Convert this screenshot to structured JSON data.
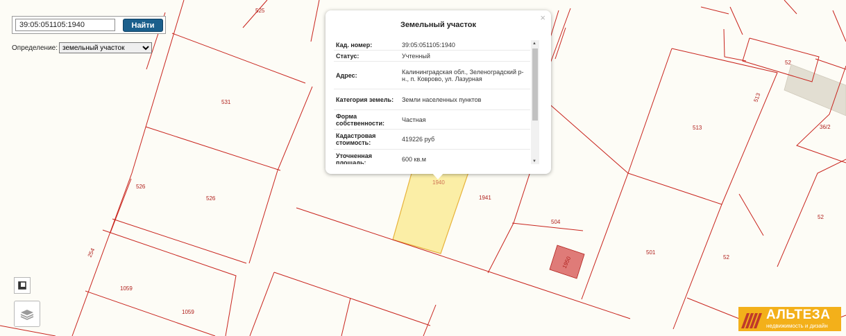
{
  "search": {
    "value": "39:05:051105:1940",
    "button_label": "Найти"
  },
  "definition": {
    "label": "Определение:",
    "selected": "земельный участок"
  },
  "popup": {
    "title": "Земельный участок",
    "close": "×",
    "rows": [
      {
        "key": "Кад. номер:",
        "value": "39:05:051105:1940"
      },
      {
        "key": "Статус:",
        "value": "Учтенный"
      },
      {
        "key": "Адрес:",
        "value": "Калининградская обл., Зеленоградский р-н., п. Коврово, ул. Лазурная"
      },
      {
        "key": "Категория земель:",
        "value": "Земли населенных пунктов"
      },
      {
        "key": "Форма собственности:",
        "value": "Частная"
      },
      {
        "key": "Кадастровая стоимость:",
        "value": "419226 руб"
      },
      {
        "key": "Уточненная площадь:",
        "value": "600 кв.м"
      }
    ]
  },
  "map": {
    "parcel_labels": [
      "525",
      "531",
      "526",
      "526",
      "254",
      "1059",
      "1059",
      "1940",
      "1941",
      "504",
      "1950",
      "501",
      "52",
      "52",
      "52",
      "513",
      "513",
      "36/2"
    ],
    "colors": {
      "boundary": "#c8231c",
      "selected_fill": "#fbeea6",
      "selected_stroke": "#e7b23a",
      "building": "#df7b78"
    }
  },
  "tools": {
    "print_icon": "frame-icon",
    "layers_icon": "layers-icon"
  },
  "logo": {
    "name": "АЛЬТЕЗА",
    "tagline": "недвижимость и дизайн"
  }
}
